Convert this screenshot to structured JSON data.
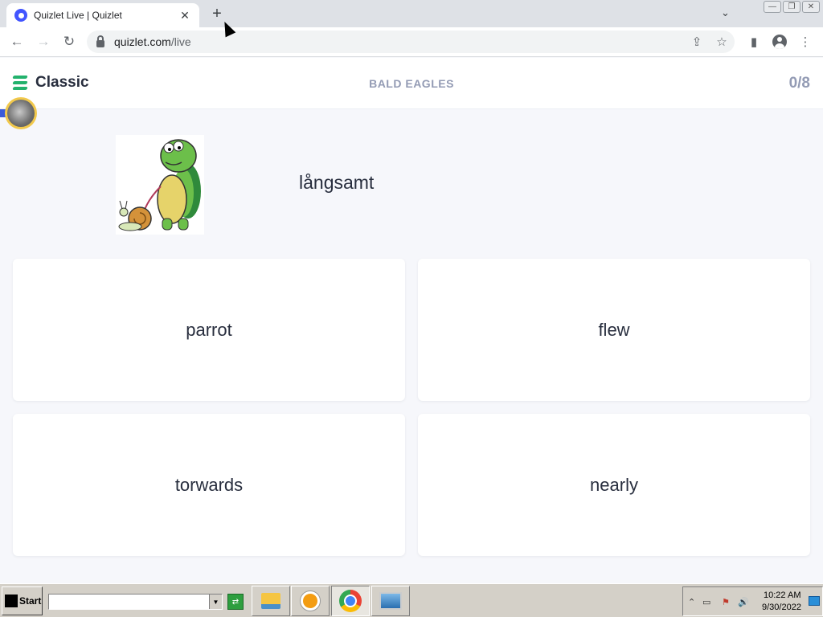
{
  "browser": {
    "tab_title": "Quizlet Live | Quizlet",
    "tab_close": "✕",
    "new_tab": "+",
    "tab_dropdown": "⌄",
    "url_host": "quizlet.com",
    "url_path": "/live",
    "nav": {
      "back": "←",
      "forward": "→",
      "reload": "↻"
    },
    "actions": {
      "share": "⇪",
      "bookmark": "☆",
      "sidepanel": "▮",
      "menu": "⋮"
    },
    "window": {
      "minimize": "—",
      "restore": "❐",
      "close": "✕"
    }
  },
  "game": {
    "mode_label": "Classic",
    "set_title": "BALD EAGLES",
    "score": "0/8",
    "prompt_term": "långsamt",
    "answers": [
      {
        "label": "parrot"
      },
      {
        "label": "flew"
      },
      {
        "label": "torwards"
      },
      {
        "label": "nearly"
      }
    ]
  },
  "colors": {
    "brand_green": "#23b26d",
    "text_dark": "#282e3e",
    "text_muted": "#939bb4",
    "page_bg": "#f6f7fb"
  },
  "taskbar": {
    "start_label": "Start",
    "go_icon": "⇄",
    "tray": {
      "arrow": "⌃",
      "network": "▭",
      "flag": "⚑",
      "volume": "🔊"
    },
    "clock_time": "10:22 AM",
    "clock_date": "9/30/2022"
  }
}
